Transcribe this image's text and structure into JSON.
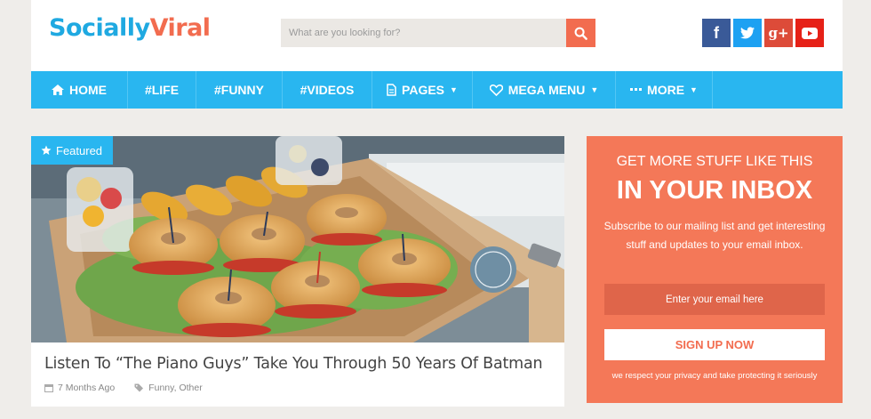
{
  "logo": {
    "part1": "Socially",
    "part2": "Viral"
  },
  "search": {
    "placeholder": "What are you looking for?"
  },
  "social": [
    {
      "name": "facebook",
      "glyph": "f"
    },
    {
      "name": "twitter",
      "glyph": "t"
    },
    {
      "name": "google-plus",
      "glyph": "g+"
    },
    {
      "name": "youtube",
      "glyph": "▶"
    }
  ],
  "nav": {
    "items": [
      {
        "label": "HOME",
        "icon": "home-icon"
      },
      {
        "label": "#LIFE"
      },
      {
        "label": "#FUNNY"
      },
      {
        "label": "#VIDEOS"
      },
      {
        "label": "PAGES",
        "icon": "file-icon",
        "dropdown": true
      },
      {
        "label": "MEGA MENU",
        "icon": "heart-icon",
        "dropdown": true
      },
      {
        "label": "MORE",
        "icon": "ellipsis-icon",
        "dropdown": true
      }
    ]
  },
  "post": {
    "badge": "Featured",
    "title": "Listen To “The Piano Guys” Take You Through 50 Years Of Batman",
    "date": "7 Months Ago",
    "categories": "Funny, Other"
  },
  "newsletter": {
    "heading1": "GET MORE STUFF LIKE THIS",
    "heading2": "IN YOUR INBOX",
    "body": "Subscribe to our mailing list and get interesting stuff and updates to your email inbox.",
    "email_placeholder": "Enter your email here",
    "button": "SIGN UP NOW",
    "note": "we respect your privacy and take protecting it seriously"
  },
  "colors": {
    "accent_blue": "#29b6f0",
    "accent_orange": "#f26c4f",
    "sidebar_bg": "#f47858"
  }
}
